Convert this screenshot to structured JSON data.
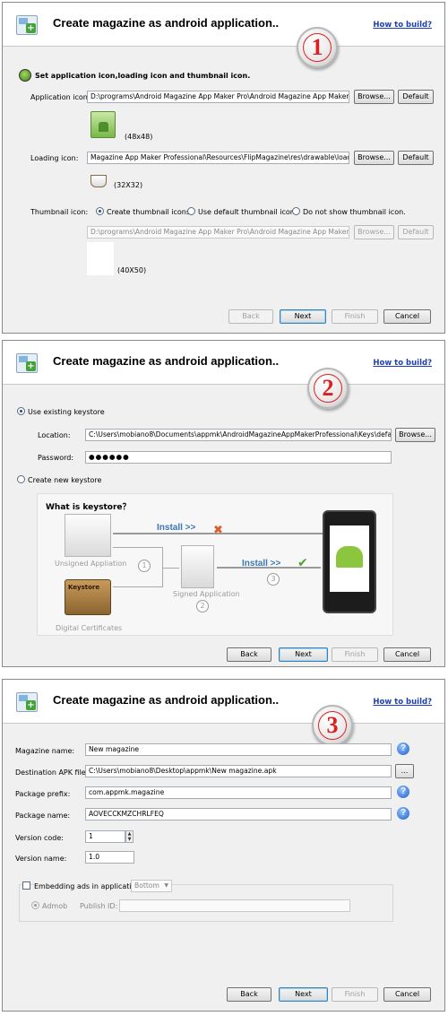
{
  "panel1": {
    "title": "Create magazine as android application..",
    "how_to_build": "How to build?",
    "step": "1",
    "section_label": "Set application icon,loading icon and thumbnail icon.",
    "app_icon_label": "Application icon:",
    "app_icon_path": "D:\\programs\\Android Magazine App Maker Pro\\Android Magazine App Maker Profe",
    "app_icon_size": "(48x48)",
    "loading_icon_label": "Loading icon:",
    "loading_icon_path": "Magazine App Maker Professional\\Resources\\FlipMagazine\\res\\drawable\\load.png",
    "loading_icon_size": "(32X32)",
    "thumbnail_label": "Thumbnail icon:",
    "thumb_options": [
      "Create thumbnail icons.",
      "Use default thumbnail icon.",
      "Do not show thumbnail icon."
    ],
    "thumb_path": "D:\\programs\\Android Magazine App Maker Pro\\Android Magazine App Maker Profe",
    "thumb_size": "(40X50)",
    "browse": "Browse...",
    "default": "Default",
    "back": "Back",
    "next": "Next",
    "finish": "Finish",
    "cancel": "Cancel"
  },
  "panel2": {
    "title": "Create magazine as android application..",
    "how_to_build": "How to build?",
    "step": "2",
    "use_existing": "Use existing keystore",
    "location_label": "Location:",
    "location_value": "C:\\Users\\mobiano8\\Documents\\appmk\\AndroidMagazineAppMakerProfessional\\Keys\\default.key",
    "password_label": "Password:",
    "password_value": "●●●●●●",
    "create_new": "Create new keystore",
    "browse": "Browse...",
    "diagram": {
      "title": "What is keystore？",
      "install": "Install >>",
      "unsigned": "Unsigned Appliation",
      "signed": "Signed Application",
      "keystore": "Keystore",
      "digital_certificates": "Digital Certificates",
      "n1": "1",
      "n2": "2",
      "n3": "3"
    },
    "back": "Back",
    "next": "Next",
    "finish": "Finish",
    "cancel": "Cancel"
  },
  "panel3": {
    "title": "Create magazine as android application..",
    "how_to_build": "How to build?",
    "step": "3",
    "magazine_name_label": "Magazine name:",
    "magazine_name_value": "New magazine",
    "dest_label": "Destination APK file:",
    "dest_value": "C:\\Users\\mobiano8\\Desktop\\appmk\\New magazine.apk",
    "dest_button": "...",
    "prefix_label": "Package prefix:",
    "prefix_value": "com.appmk.magazine",
    "package_label": "Package name:",
    "package_value": "AOVECCKMZCHRLFEQ",
    "version_code_label": "Version code:",
    "version_code_value": "1",
    "version_name_label": "Version name:",
    "version_name_value": "1.0",
    "embed_label": "Embedding ads in application",
    "embed_position": "Bottom",
    "admob": "Admob",
    "publish_id_label": "Publish ID:",
    "help": "?",
    "back": "Back",
    "next": "Next",
    "finish": "Finish",
    "cancel": "Cancel"
  }
}
